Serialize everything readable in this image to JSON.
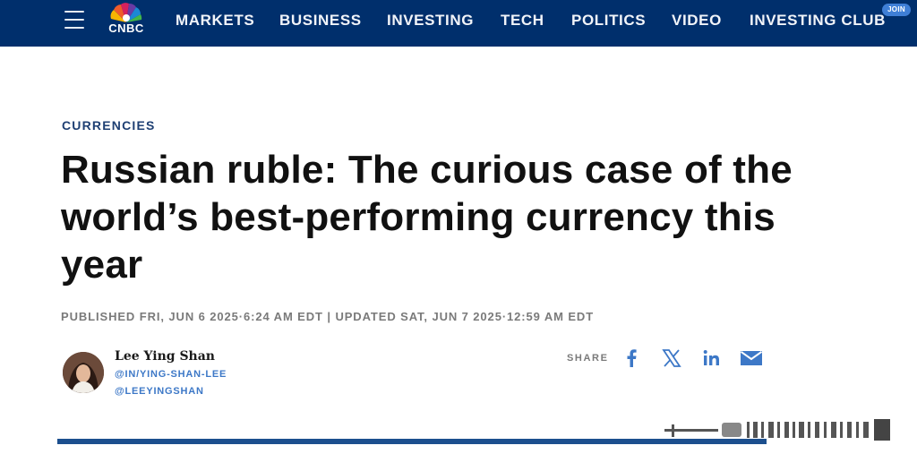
{
  "header": {
    "brand": "CNBC",
    "nav": [
      "MARKETS",
      "BUSINESS",
      "INVESTING",
      "TECH",
      "POLITICS",
      "VIDEO",
      "INVESTING CLUB"
    ],
    "join_badge": "JOIN"
  },
  "article": {
    "category": "CURRENCIES",
    "title": "Russian ruble: The curious case of the world’s best-performing currency this year",
    "published": "PUBLISHED FRI, JUN 6 2025·6:24 AM EDT | UPDATED SAT, JUN 7 2025·12:59 AM EDT"
  },
  "author": {
    "name": "Lee Ying Shan",
    "linkedin": "@IN/YING-SHAN-LEE",
    "twitter": "@LEEYINGSHAN"
  },
  "share": {
    "label": "SHARE",
    "icons": [
      "facebook-icon",
      "x-icon",
      "linkedin-icon",
      "email-icon"
    ]
  },
  "colors": {
    "nav_bg": "#002f6c",
    "category": "#1e3f73",
    "link": "#3d78c7",
    "divider": "#1c4f8e"
  }
}
